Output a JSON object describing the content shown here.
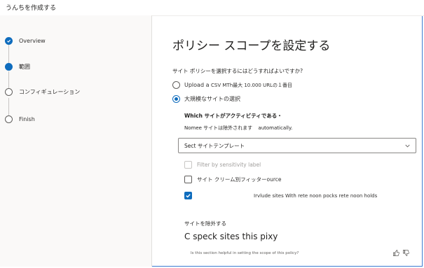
{
  "app": {
    "title": "うんちを作成する"
  },
  "steps": [
    {
      "label": "Overview",
      "state": "done"
    },
    {
      "label": "範囲",
      "state": "current"
    },
    {
      "label": "コンフィギュレーション",
      "state": "todo"
    },
    {
      "label": "Finish",
      "state": "todo"
    }
  ],
  "main": {
    "title": "ポリシー スコープを設定する",
    "question": "サイト ポリシーを選択するにはどうすればよいですか?",
    "options": [
      {
        "label": "Upload a",
        "detail": "CSV MTh最大 10.000 URLの１番目",
        "selected": false
      },
      {
        "label": "大規模なサイトの選択",
        "detail": "",
        "selected": true
      }
    ],
    "sites_heading": "Which サイトがアクティビティである・",
    "note": "Nomee サイトは除外されます",
    "note_suffix": "automatically.",
    "template_select": {
      "value": "Sect サイトテンプレート"
    },
    "checkboxes": [
      {
        "label": "Filter by sensitivity label",
        "checked": false,
        "disabled": true
      },
      {
        "label": "サイト クリーム別フィッターource",
        "checked": false,
        "disabled": false
      },
      {
        "label": "Irvlude sites With rete noon pocks rete noon holds",
        "checked": true,
        "disabled": false
      }
    ],
    "exclude_heading": "サイトを除外する",
    "exclude_text": "C speck sites this pixy",
    "feedback_question": "Is this section helpful in setting the scope of this policy?"
  },
  "icons": {
    "check": "check-icon",
    "chevron": "chevron-down-icon",
    "thumbs_up": "thumbs-up-icon",
    "thumbs_down": "thumbs-down-icon"
  },
  "colors": {
    "accent": "#0f6cbd",
    "border": "#3b7bd0"
  }
}
